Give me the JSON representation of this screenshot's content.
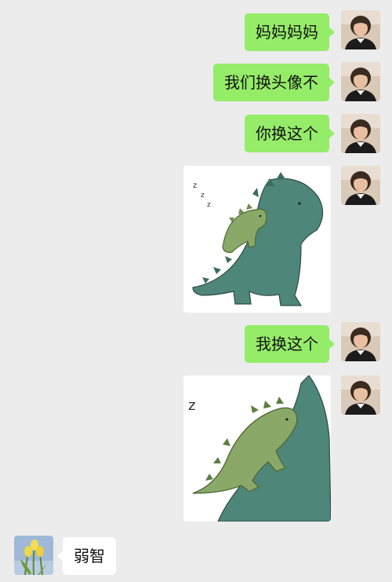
{
  "chat": {
    "messages": [
      {
        "sender": "me",
        "type": "text",
        "text": "妈妈妈妈"
      },
      {
        "sender": "me",
        "type": "text",
        "text": "我们换头像不"
      },
      {
        "sender": "me",
        "type": "text",
        "text": "你换这个"
      },
      {
        "sender": "me",
        "type": "image",
        "image": "dinosaur-sticker-sleeping"
      },
      {
        "sender": "me",
        "type": "text",
        "text": "我换这个"
      },
      {
        "sender": "me",
        "type": "image",
        "image": "dinosaur-sticker-closeup"
      },
      {
        "sender": "other",
        "type": "text",
        "text": "弱智"
      }
    ]
  },
  "colors": {
    "background": "#ececec",
    "my_bubble": "#95ec69",
    "other_bubble": "#ffffff",
    "big_dino": "#4e8679",
    "small_dino": "#8aa867"
  },
  "icons": {
    "my_avatar": "person-photo-avatar",
    "other_avatar": "tulip-flowers-avatar"
  }
}
